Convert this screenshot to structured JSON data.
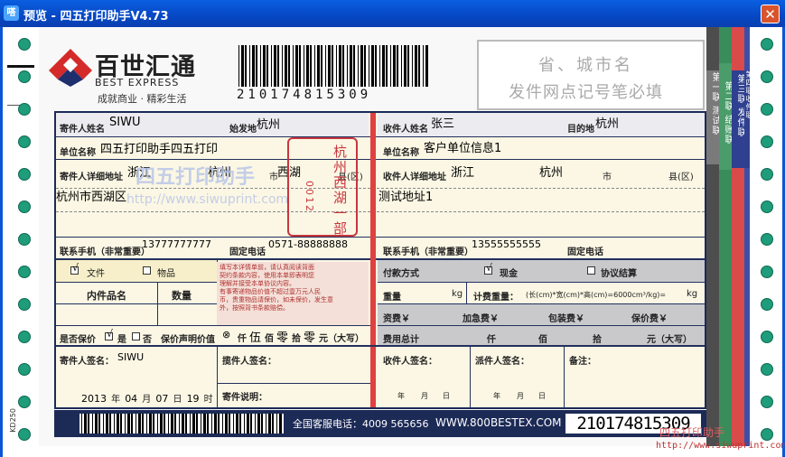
{
  "window": {
    "app_icon": "嗒",
    "title": "预览 - 四五打印助手V4.73",
    "close_symbol": "✕"
  },
  "waybill": {
    "brand_cn": "百世汇通",
    "brand_en": "BEST EXPRESS",
    "slogan": "成就商业 · 精彩生活",
    "barcode_number": "210174815309",
    "top_right_line1": "省、城市名",
    "top_right_line2": "发件网点记号笔必填",
    "sender": {
      "name_label": "寄件人姓名",
      "name_value": "SIWU",
      "origin_label": "始发地",
      "origin_value": "杭州",
      "company_label": "单位名称",
      "company_value": "四五打印助手四五打印",
      "address_label": "寄件人详细地址",
      "province_value": "浙江",
      "city_value": "杭州",
      "city_label": "市",
      "district_value": "西湖",
      "district_label": "县(区)",
      "address_line": "杭州市西湖区",
      "phone_label": "联系手机（非常重要）",
      "phone_value": "13777777777",
      "landline_label": "固定电话",
      "landline_value": "0571-88888888"
    },
    "receiver": {
      "name_label": "收件人姓名",
      "name_value": "张三",
      "dest_label": "目的地",
      "dest_value": "杭州",
      "company_label": "单位名称",
      "company_value": "客户单位信息1",
      "address_label": "收件人详细地址",
      "province_value": "浙江",
      "city_value": "杭州",
      "city_label": "市",
      "district_label": "县(区)",
      "address_line": "测试地址1",
      "phone_label": "联系手机（非常重要）",
      "phone_value": "13555555555",
      "landline_label": "固定电话"
    },
    "stamp_text": "杭州西湖一部",
    "stamp_code": "0012",
    "watermark_text": "四五打印助手",
    "watermark_url": "http://www.siwuprint.com",
    "contents": {
      "doc_label": "文件",
      "goods_label": "物品",
      "item_name_label": "内件品名",
      "qty_label": "数量",
      "doc_checked": "√",
      "notice_lines": [
        "填写本详情单前，请认真阅读背面",
        "契约条款内容，使用本单即表明您",
        "理解并接受本单协议内容。",
        "有事寄递物品价值不超过壹万元人民",
        "币，贵重物品请保价，如未保价，发生意",
        "外，按照背书条款赔偿。"
      ]
    },
    "payment": {
      "method_label": "付款方式",
      "cash_label": "现金",
      "cash_checked": "√",
      "contract_label": "协议结算",
      "weight_label": "重量",
      "weight_unit": "kg",
      "charge_weight_label": "计费重量：",
      "charge_weight_formula": "(长(cm)*宽(cm)*高(cm)=6000cm³/kg)=",
      "charge_weight_unit": "kg",
      "freight_label": "资费￥",
      "urgent_label": "加急费￥",
      "pack_label": "包装费￥",
      "insure_fee_label": "保价费￥",
      "total_label": "费用总计",
      "total_units": [
        "仟",
        "佰",
        "拾",
        "元（大写）"
      ]
    },
    "insurance": {
      "label": "是否保价",
      "yes_label": "是",
      "yes_checked": "√",
      "no_label": "否",
      "declared_label": "保价声明价值",
      "declared_value_symbol": "⊗",
      "declared_units": [
        "仟",
        "伍",
        "佰",
        "零",
        "拾",
        "零",
        "元（大写）"
      ]
    },
    "signatures": {
      "sender_sign_label": "寄件人签名：",
      "sender_sign_value": "SIWU",
      "pickup_label": "揽件人签名：",
      "date_year": "2013",
      "date_year_unit": "年",
      "date_month": "04",
      "date_month_unit": "月",
      "date_day": "07",
      "date_day_unit": "日",
      "date_hour": "19",
      "date_hour_unit": "时",
      "note_label": "寄件说明：",
      "receiver_sign_label": "收件人签名：",
      "delivery_sign_label": "派件人签名：",
      "remarks_label": "备注：",
      "ymd_units": [
        "年",
        "月",
        "日"
      ]
    },
    "footer": {
      "service_label": "全国客服电话：4009 565656",
      "website": "WWW.800BESTEX.COM",
      "bottom_number": "210174815309",
      "side_code": "KD250"
    },
    "copies": [
      {
        "line1": "第一联",
        "line2": "测试联"
      },
      {
        "line1": "第二联",
        "line2": "结账联"
      },
      {
        "line1": "第三联",
        "line2": "发件联"
      },
      {
        "line1": "第四联",
        "line2": "收件联"
      }
    ],
    "brand_watermark_logo": "四五打印助手"
  }
}
